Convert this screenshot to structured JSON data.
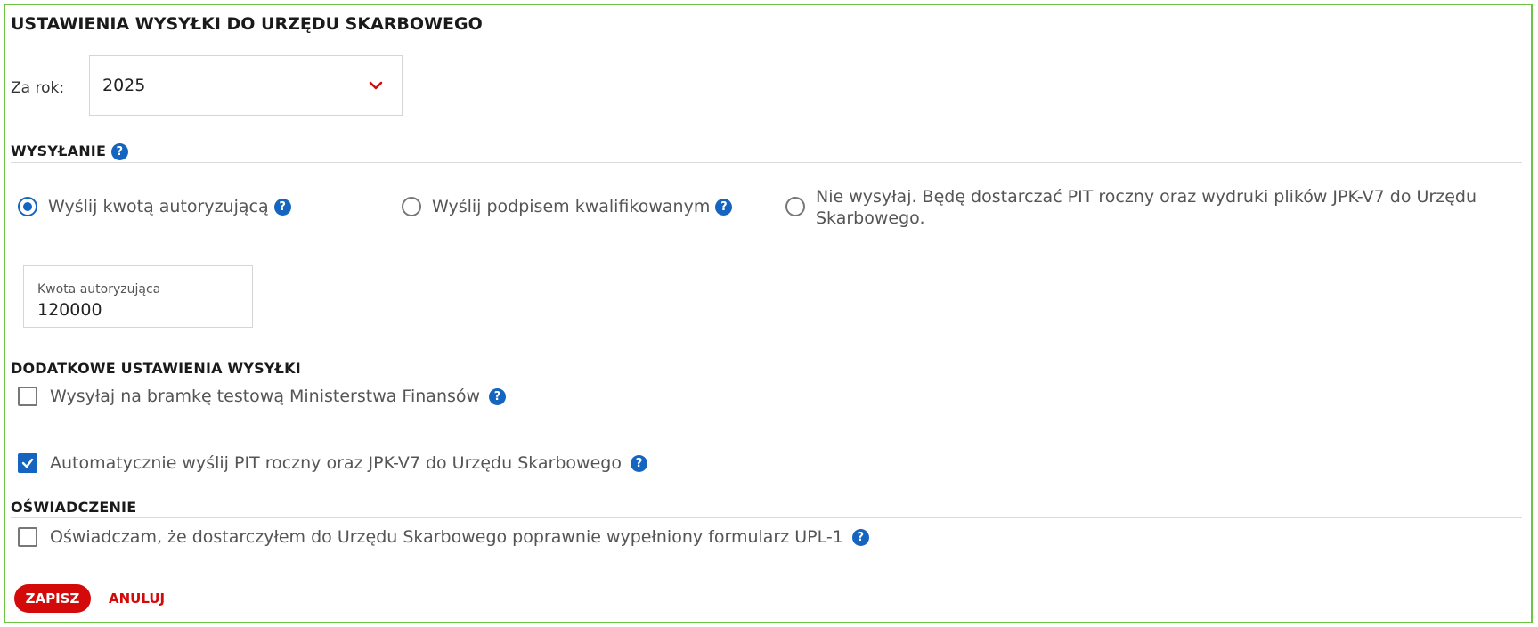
{
  "title": "USTAWIENIA WYSYŁKI DO URZĘDU SKARBOWEGO",
  "year": {
    "label": "Za rok:",
    "value": "2025"
  },
  "sending": {
    "title": "WYSYŁANIE",
    "options": [
      {
        "label": "Wyślij kwotą autoryzującą",
        "checked": true
      },
      {
        "label": "Wyślij podpisem kwalifikowanym",
        "checked": false
      },
      {
        "label_line1": "Nie wysyłaj. Będę dostarczać PIT roczny oraz wydruki plików JPK-V7 do Urzędu",
        "label_line2": "Skarbowego.",
        "checked": false
      }
    ],
    "amount_label": "Kwota autoryzująca",
    "amount_value": "120000"
  },
  "additional": {
    "title": "DODATKOWE USTAWIENIA WYSYŁKI",
    "test_gateway": {
      "label": "Wysyłaj na bramkę testową Ministerstwa Finansów",
      "checked": false
    },
    "auto_send": {
      "label": "Automatycznie wyślij PIT roczny oraz JPK-V7 do Urzędu Skarbowego",
      "checked": true
    }
  },
  "declaration": {
    "title": "OŚWIADCZENIE",
    "upl1": {
      "label": "Oświadczam, że dostarczyłem do Urzędu Skarbowego poprawnie wypełniony formularz UPL-1",
      "checked": false
    }
  },
  "buttons": {
    "save": "ZAPISZ",
    "cancel": "ANULUJ"
  },
  "help_glyph": "?",
  "colors": {
    "accent": "#1565c0",
    "danger": "#d40a0a",
    "frame": "#6cc644"
  }
}
